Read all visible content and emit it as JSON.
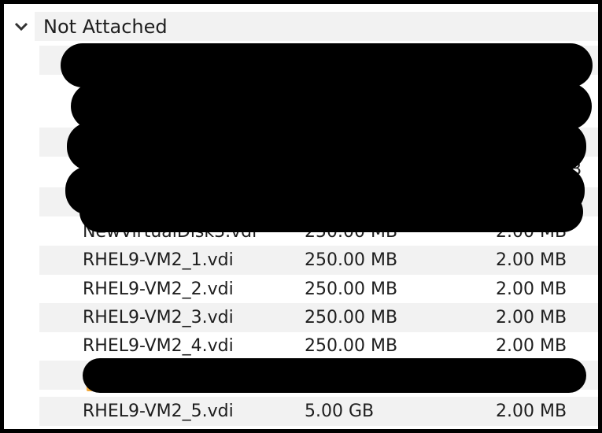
{
  "group": {
    "label": "Not Attached",
    "expanded": true
  },
  "rows": [
    {
      "name": "RHEL9-VM2_1.vdi",
      "virtual_size": "250.00 MB",
      "actual_size": "2.00 MB"
    },
    {
      "name": "RHEL9-VM2_2.vdi",
      "virtual_size": "250.00 MB",
      "actual_size": "2.00 MB"
    },
    {
      "name": "RHEL9-VM2_3.vdi",
      "virtual_size": "250.00 MB",
      "actual_size": "2.00 MB"
    },
    {
      "name": "RHEL9-VM2_4.vdi",
      "virtual_size": "250.00 MB",
      "actual_size": "2.00 MB"
    },
    {
      "name": "RHEL9-VM2_5.vdi",
      "virtual_size": "5.00 GB",
      "actual_size": "2.00 MB"
    }
  ],
  "partial_rows": {
    "above_first": {
      "name": "NewVirtualDisk3.vdi",
      "virtual_size": "250.00 MB",
      "actual_size": "2.00 MB"
    },
    "right_edge_text": "MB"
  },
  "colors": {
    "row_alt_bg": "#f2f2f2",
    "text": "#1e1e1e",
    "frame": "#000000",
    "redaction": "#000000",
    "disk_icon_accent": "#f0a83a"
  },
  "icons": {
    "group_toggle": "chevron-down-icon",
    "disk_icon": "virtual-disk-icon"
  }
}
